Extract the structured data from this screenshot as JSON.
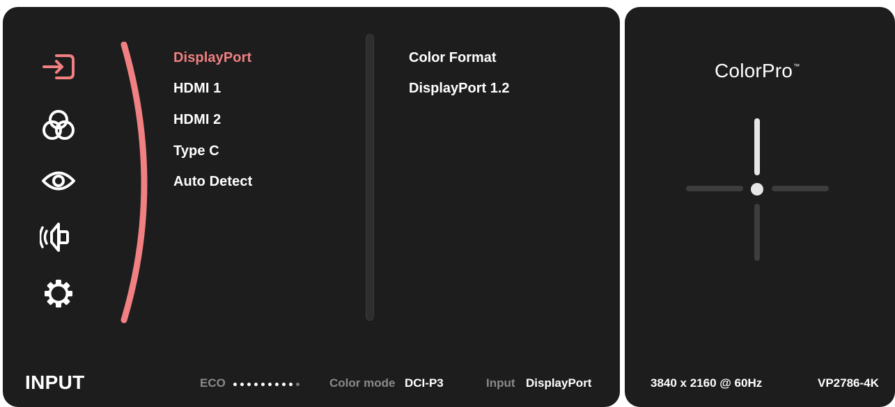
{
  "colors": {
    "panel_bg": "#1d1d1d",
    "accent": "#f08081",
    "text": "#ffffff",
    "dim_text": "#8a8a8a"
  },
  "sidebar": {
    "icons": [
      "input-icon",
      "color-icon",
      "eye-icon",
      "audio-icon",
      "settings-icon"
    ]
  },
  "menu": {
    "items": [
      {
        "label": "DisplayPort",
        "active": true
      },
      {
        "label": "HDMI 1",
        "active": false
      },
      {
        "label": "HDMI 2",
        "active": false
      },
      {
        "label": "Type C",
        "active": false
      },
      {
        "label": "Auto Detect",
        "active": false
      }
    ]
  },
  "submenu": {
    "title": "Color Format",
    "value": "DisplayPort 1.2"
  },
  "footer": {
    "section_title": "INPUT",
    "eco_label": "ECO",
    "eco_level": 9,
    "eco_total": 10,
    "color_mode_label": "Color mode",
    "color_mode_value": "DCI-P3",
    "input_label": "Input",
    "input_value": "DisplayPort"
  },
  "side": {
    "brand": "ColorPro",
    "brand_mark": "™",
    "resolution": "3840 x 2160 @ 60Hz",
    "model": "VP2786-4K"
  }
}
